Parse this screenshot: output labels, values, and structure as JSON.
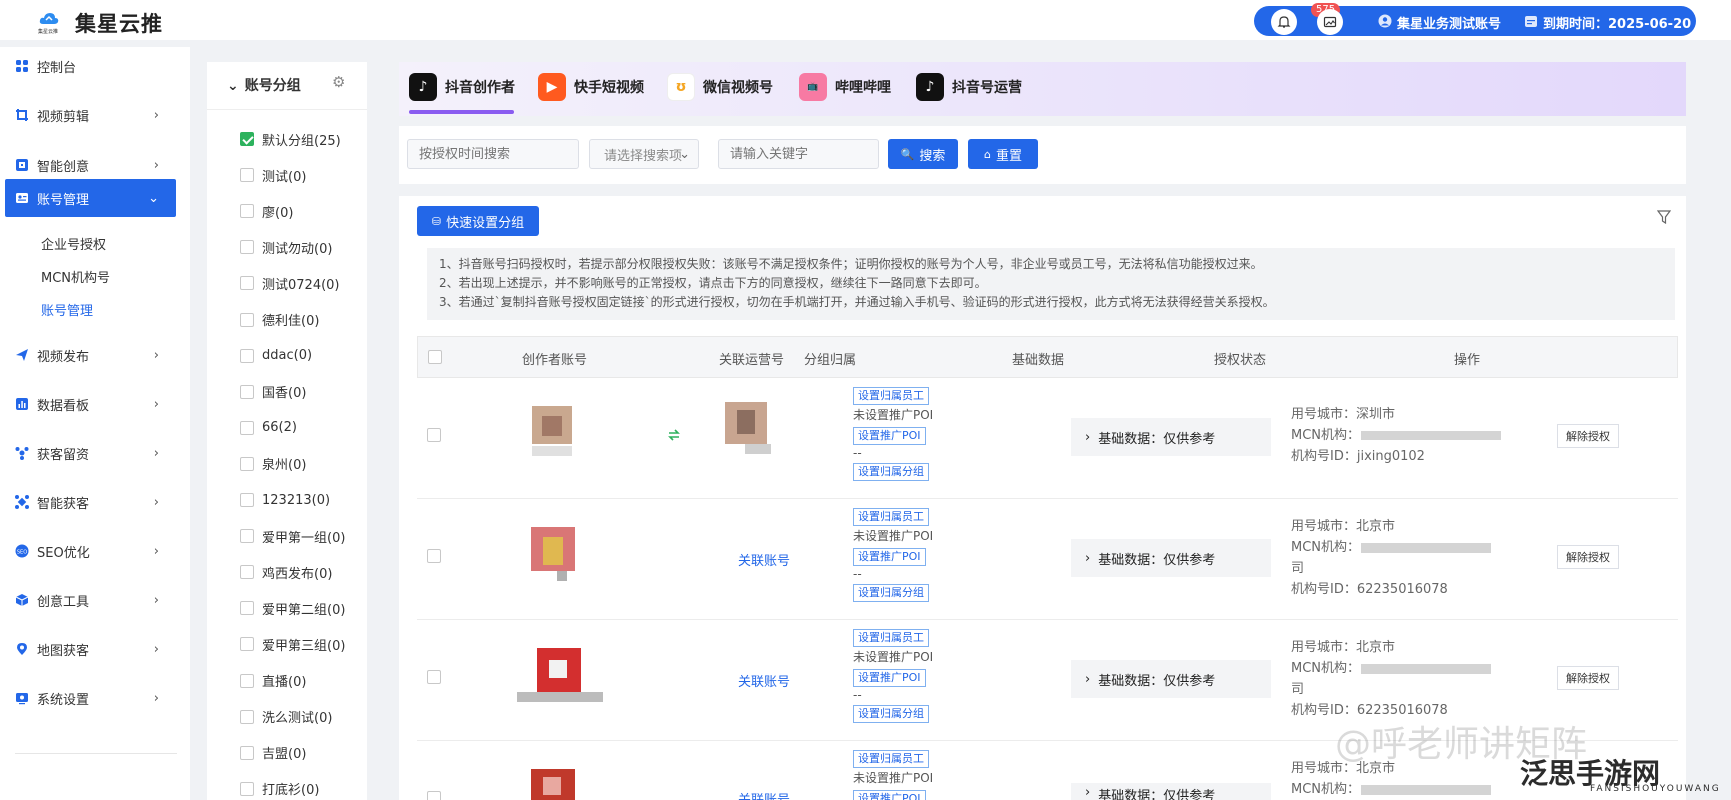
{
  "app": {
    "title": "集星云推",
    "logo_caption": "集星云推"
  },
  "topbar": {
    "notification_count": "575",
    "account_name": "集星业务测试账号",
    "expiry": "到期时间：2025-06-20"
  },
  "sidebar": {
    "items": [
      {
        "label": "控制台"
      },
      {
        "label": "视频剪辑"
      },
      {
        "label": "智能创意"
      },
      {
        "label": "账号管理"
      },
      {
        "label": "视频发布"
      },
      {
        "label": "数据看板"
      },
      {
        "label": "获客留资"
      },
      {
        "label": "智能获客"
      },
      {
        "label": "SEO优化"
      },
      {
        "label": "创意工具"
      },
      {
        "label": "地图获客"
      },
      {
        "label": "系统设置"
      }
    ],
    "subitems": [
      {
        "label": "企业号授权"
      },
      {
        "label": "MCN机构号"
      },
      {
        "label": "账号管理"
      }
    ]
  },
  "groups": {
    "title": "账号分组",
    "items": [
      {
        "label": "默认分组(25)"
      },
      {
        "label": "测试(0)"
      },
      {
        "label": "廖(0)"
      },
      {
        "label": "测试勿动(0)"
      },
      {
        "label": "测试0724(0)"
      },
      {
        "label": "德利佳(0)"
      },
      {
        "label": "ddac(0)"
      },
      {
        "label": "国香(0)"
      },
      {
        "label": "66(2)"
      },
      {
        "label": "泉州(0)"
      },
      {
        "label": "123213(0)"
      },
      {
        "label": "爱甲第一组(0)"
      },
      {
        "label": "鸡西发布(0)"
      },
      {
        "label": "爱甲第二组(0)"
      },
      {
        "label": "爱甲第三组(0)"
      },
      {
        "label": "直播(0)"
      },
      {
        "label": "洗么测试(0)"
      },
      {
        "label": "吉盟(0)"
      },
      {
        "label": "打底衫(0)"
      }
    ]
  },
  "tabs": [
    {
      "label": "抖音创作者"
    },
    {
      "label": "快手短视频"
    },
    {
      "label": "微信视频号"
    },
    {
      "label": "哔哩哔哩"
    },
    {
      "label": "抖音号运营"
    }
  ],
  "search": {
    "time_placeholder": "按授权时间搜索",
    "select_placeholder": "请选择搜索项",
    "keyword_placeholder": "请输入关键字",
    "search_label": "搜索",
    "reset_label": "重置"
  },
  "toolbar": {
    "quick_group_label": "快速设置分组"
  },
  "notice": [
    "1、抖音账号扫码授权时，若提示部分权限授权失败：该账号不满足授权条件；证明你授权的账号为个人号，非企业号或员工号，无法将私信功能授权过来。",
    "2、若出现上述提示，并不影响账号的正常授权，请点击下方的同意授权，继续往下一路同意下去即可。",
    "3、若通过`复制抖音账号授权固定链接`的形式进行授权，切勿在手机端打开，并通过输入手机号、验证码的形式进行授权，此方式将无法获得经营关系授权。"
  ],
  "table": {
    "headers": [
      "创作者账号",
      "关联运营号",
      "分组归属",
      "基础数据",
      "授权状态",
      "操作"
    ],
    "rows": [
      {
        "linked": "",
        "tag_staff": "设置归属员工",
        "poi_text": "未设置推广POI",
        "tag_poi": "设置推广POI",
        "dash": "--",
        "tag_group": "设置归属分组",
        "basic": "基础数据：仅供参考",
        "city": "用号城市：深圳市",
        "mcn": "MCN机构：",
        "mcn_extra": "",
        "org_id": "机构号ID：jixing0102",
        "action": "解除授权"
      },
      {
        "linked": "关联账号",
        "tag_staff": "设置归属员工",
        "poi_text": "未设置推广POI",
        "tag_poi": "设置推广POI",
        "dash": "--",
        "tag_group": "设置归属分组",
        "basic": "基础数据：仅供参考",
        "city": "用号城市：北京市",
        "mcn": "MCN机构：",
        "mcn_extra": "司",
        "org_id": "机构号ID：62235016078",
        "action": "解除授权"
      },
      {
        "linked": "关联账号",
        "tag_staff": "设置归属员工",
        "poi_text": "未设置推广POI",
        "tag_poi": "设置推广POI",
        "dash": "--",
        "tag_group": "设置归属分组",
        "basic": "基础数据：仅供参考",
        "city": "用号城市：北京市",
        "mcn": "MCN机构：",
        "mcn_extra": "司",
        "org_id": "机构号ID：62235016078",
        "action": "解除授权"
      },
      {
        "linked": "关联账号",
        "tag_staff": "设置归属员工",
        "poi_text": "未设置推广POI",
        "tag_poi": "设置推广POI",
        "dash": "",
        "tag_group": "",
        "basic": "基础数据：仅供参考",
        "city": "用号城市：北京市",
        "mcn": "MCN机构：",
        "mcn_extra": "",
        "org_id": "",
        "action": ""
      }
    ]
  },
  "overlay": {
    "watermark": "@呼老师讲矩阵",
    "site_logo": "泛思手游网",
    "site_domain": "FANSISHOUYOUWANG"
  },
  "colors": {
    "primary": "#2367e8",
    "sidebar_active": "#2367e8",
    "tab_accent": "#8a5cf0",
    "checkbox_checked": "#2db25d",
    "badge": "#f05252"
  }
}
